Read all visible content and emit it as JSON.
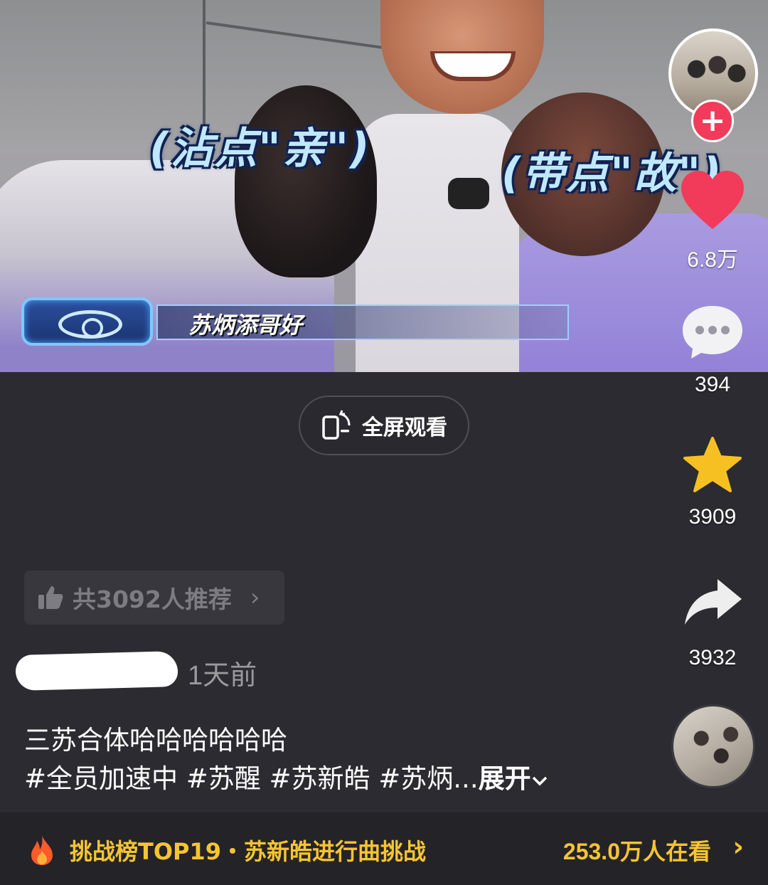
{
  "video": {
    "caption_left": "(沾点\"亲\")",
    "caption_right": "(带点\"故\")",
    "lower_third": "苏炳添哥好"
  },
  "rail": {
    "likes": "6.8万",
    "comments": "394",
    "favorites": "3909",
    "shares": "3932",
    "follow_symbol": "+"
  },
  "fullscreen": {
    "label": "全屏观看"
  },
  "recommend": {
    "label": "共3092人推荐"
  },
  "post": {
    "time": "1天前",
    "description": "三苏合体哈哈哈哈哈哈",
    "hashtags": "#全员加速中 #苏醒 #苏新皓 #苏炳...",
    "expand_label": "展开"
  },
  "challenge": {
    "label": "挑战榜TOP19・苏新皓进行曲挑战",
    "viewers": "253.0万人在看"
  },
  "colors": {
    "background": "#2c2b31",
    "like_red": "#f23b5a",
    "star_yellow": "#f7c022",
    "challenge_yellow": "#f5c531"
  },
  "icons": {
    "like": "heart-icon",
    "comment": "comment-bubble-icon",
    "favorite": "star-icon",
    "share": "share-arrow-icon",
    "fullscreen": "rotate-phone-icon",
    "recommend": "thumbs-up-icon",
    "challenge": "flame-icon"
  }
}
